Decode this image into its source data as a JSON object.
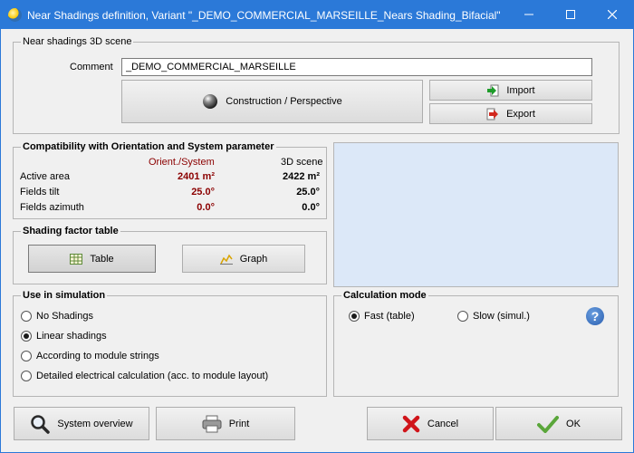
{
  "window": {
    "title": "Near Shadings definition, Variant \"_DEMO_COMMERCIAL_MARSEILLE_Nears Shading_Bifacial\"",
    "title_color": "#2b79d8"
  },
  "scene": {
    "legend": "Near shadings 3D scene",
    "comment_label": "Comment",
    "comment_value": "_DEMO_COMMERCIAL_MARSEILLE",
    "construction_label": "Construction / Perspective",
    "import_label": "Import",
    "export_label": "Export"
  },
  "compat": {
    "legend": "Compatibility with Orientation and System parameter",
    "col_orient": "Orient./System",
    "col_3d": "3D scene",
    "rows": [
      {
        "label": "Active area",
        "orient": "2401 m²",
        "scene": "2422 m²"
      },
      {
        "label": "Fields tilt",
        "orient": "25.0°",
        "scene": "25.0°"
      },
      {
        "label": "Fields azimuth",
        "orient": "0.0°",
        "scene": "0.0°"
      }
    ]
  },
  "shading_table": {
    "legend": "Shading factor table",
    "table_label": "Table",
    "graph_label": "Graph"
  },
  "use_in_sim": {
    "legend": "Use in simulation",
    "options": [
      {
        "label": "No Shadings",
        "selected": false
      },
      {
        "label": "Linear shadings",
        "selected": true
      },
      {
        "label": "According to module strings",
        "selected": false
      },
      {
        "label": "Detailed electrical calculation (acc. to module layout)",
        "selected": false
      }
    ]
  },
  "calc_mode": {
    "legend": "Calculation mode",
    "options": [
      {
        "label": "Fast (table)",
        "selected": true
      },
      {
        "label": "Slow (simul.)",
        "selected": false
      }
    ],
    "help_glyph": "?"
  },
  "footer": {
    "system_overview_label": "System overview",
    "print_label": "Print",
    "cancel_label": "Cancel",
    "ok_label": "OK"
  }
}
